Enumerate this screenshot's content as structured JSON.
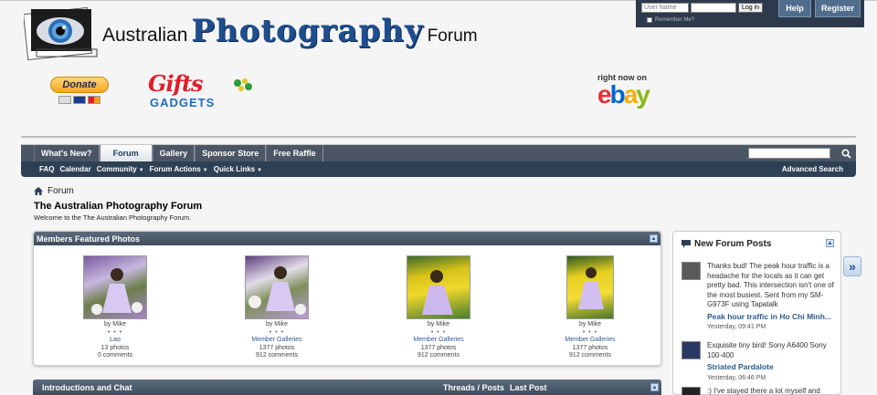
{
  "login": {
    "username_placeholder": "User Name",
    "password_placeholder": "",
    "login_label": "Log in",
    "remember_label": "Remember Me?",
    "help_label": "Help",
    "register_label": "Register"
  },
  "logo": {
    "part1": "Australian",
    "part2": "Photography",
    "part3": "Forum"
  },
  "ads": {
    "donate_label": "Donate",
    "gifts_label": "Gifts",
    "gadgets_label": "GADGETS",
    "ebay_top": "right now on",
    "ebay_colors": [
      "#e53238",
      "#0064d2",
      "#f5af02",
      "#86b817"
    ]
  },
  "nav": {
    "tabs": [
      "What's New?",
      "Forum",
      "Gallery",
      "Sponsor Store",
      "Free Raffle"
    ],
    "active_tab": "Forum",
    "sub_items": [
      {
        "label": "FAQ",
        "caret": false
      },
      {
        "label": "Calendar",
        "caret": false
      },
      {
        "label": "Community",
        "caret": true
      },
      {
        "label": "Forum Actions",
        "caret": true
      },
      {
        "label": "Quick Links",
        "caret": true
      }
    ],
    "advanced_search": "Advanced Search"
  },
  "breadcrumb": {
    "label": "Forum"
  },
  "page": {
    "title": "The Australian Photography Forum",
    "subtitle": "Welcome to the The Australian Photography Forum."
  },
  "featured": {
    "title": "Members Featured Photos",
    "photos": [
      {
        "by": "by Mike",
        "dots": "• • •",
        "gallery": "Lao",
        "photos": "13 photos",
        "comments": "0 comments"
      },
      {
        "by": "by Mike",
        "dots": "• • •",
        "gallery": "Member Galleries",
        "photos": "1377 photos",
        "comments": "912 comments"
      },
      {
        "by": "by Mike",
        "dots": "• • •",
        "gallery": "Member Galleries",
        "photos": "1377 photos",
        "comments": "912 comments"
      },
      {
        "by": "by Mike",
        "dots": "• • •",
        "gallery": "Member Galleries",
        "photos": "1377 photos",
        "comments": "912 comments"
      }
    ]
  },
  "intro": {
    "title": "Introductions and Chat",
    "threads_posts": "Threads / Posts",
    "last_post": "Last Post"
  },
  "sidebar": {
    "title": "New Forum Posts",
    "posts": [
      {
        "text": "Thanks bud! The peak hour traffic is a headache for the locals as it can get pretty bad. This intersection isn't one of the most busiest. Sent from my SM-G973F using Tapatalk",
        "title": "Peak hour traffic in Ho Chi Minh...",
        "time": "Yesterday, 09:41 PM"
      },
      {
        "text": "Exquisite tiny bird! Sony A6400 Sony 100-400",
        "title": "Striated Pardalote",
        "time": "Yesterday, 06:46 PM"
      },
      {
        "text": ":) I've stayed there a lot myself and",
        "title": "",
        "time": ""
      }
    ]
  }
}
